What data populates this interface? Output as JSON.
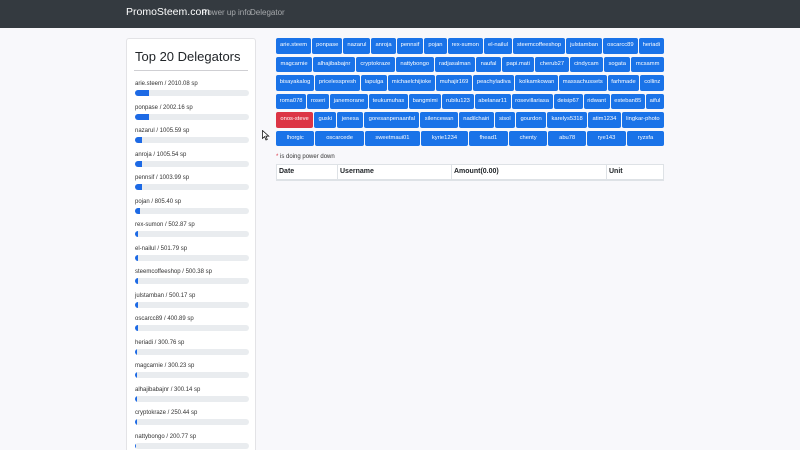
{
  "navbar": {
    "brand": "PromoSteem.com",
    "links": [
      "Power up info",
      "Delegator"
    ]
  },
  "sidebar": {
    "title": "Top 20 Delegators",
    "delegators": [
      {
        "label": "arie.steem / 2010.08 sp",
        "progress": 0.12
      },
      {
        "label": "ponpase / 2002.16 sp",
        "progress": 0.12
      },
      {
        "label": "nazarul / 1005.59 sp",
        "progress": 0.06
      },
      {
        "label": "anroja / 1005.54 sp",
        "progress": 0.06
      },
      {
        "label": "pennsif / 1003.99 sp",
        "progress": 0.06
      },
      {
        "label": "pojan / 805.40 sp",
        "progress": 0.045
      },
      {
        "label": "rex-sumon / 502.87 sp",
        "progress": 0.03
      },
      {
        "label": "el-nailul / 501.79 sp",
        "progress": 0.03
      },
      {
        "label": "steemcoffeeshop / 500.38 sp",
        "progress": 0.03
      },
      {
        "label": "julstamban / 500.17 sp",
        "progress": 0.03
      },
      {
        "label": "oscarcc89 / 400.89 sp",
        "progress": 0.025
      },
      {
        "label": "heriadi / 300.76 sp",
        "progress": 0.02
      },
      {
        "label": "magcarnie / 300.23 sp",
        "progress": 0.02
      },
      {
        "label": "alhajibabajnr / 300.14 sp",
        "progress": 0.02
      },
      {
        "label": "cryptokraze / 250.44 sp",
        "progress": 0.015
      },
      {
        "label": "nattybongo / 200.77 sp",
        "progress": 0.012
      }
    ]
  },
  "user_rows": [
    [
      {
        "name": "arie.steem"
      },
      {
        "name": "ponpase"
      },
      {
        "name": "nazarul"
      },
      {
        "name": "anroja"
      },
      {
        "name": "pennsif"
      },
      {
        "name": "pojan"
      },
      {
        "name": "rex-sumon"
      },
      {
        "name": "el-nailul"
      },
      {
        "name": "steemcoffeeshop"
      },
      {
        "name": "julstamban"
      },
      {
        "name": "oscarcc89"
      },
      {
        "name": "heriadi"
      }
    ],
    [
      {
        "name": "magcarnie"
      },
      {
        "name": "alhajibabajnr"
      },
      {
        "name": "cryptokraze"
      },
      {
        "name": "nattybongo"
      },
      {
        "name": "radjasalman"
      },
      {
        "name": "naufal"
      },
      {
        "name": "papi.mati"
      },
      {
        "name": "cherub27"
      },
      {
        "name": "cindycam"
      },
      {
        "name": "sogata"
      },
      {
        "name": "mcsamm"
      }
    ],
    [
      {
        "name": "bisayakalog"
      },
      {
        "name": "pricelesspresh"
      },
      {
        "name": "lapulga"
      },
      {
        "name": "michaelchijioke"
      },
      {
        "name": "muhajir169"
      },
      {
        "name": "peachyladiva"
      },
      {
        "name": "kolkamkowan"
      },
      {
        "name": "massachussets"
      },
      {
        "name": "farhmade"
      },
      {
        "name": "collinz"
      }
    ],
    [
      {
        "name": "roma078"
      },
      {
        "name": "roseri"
      },
      {
        "name": "janemorane"
      },
      {
        "name": "teukumuhas"
      },
      {
        "name": "bangmimi"
      },
      {
        "name": "rubilu123"
      },
      {
        "name": "abelanar11"
      },
      {
        "name": "rosevillariasa"
      },
      {
        "name": "deisip67"
      },
      {
        "name": "ridwant"
      },
      {
        "name": "esteban85"
      },
      {
        "name": "aiful"
      }
    ],
    [
      {
        "name": "onos-steve",
        "power_down": true
      },
      {
        "name": "guski"
      },
      {
        "name": "jenesa"
      },
      {
        "name": "goresanpenaanfal"
      },
      {
        "name": "silencewan"
      },
      {
        "name": "nadilchairi"
      },
      {
        "name": "sisol"
      },
      {
        "name": "gourdon"
      },
      {
        "name": "karelys5318"
      },
      {
        "name": "atim1234"
      },
      {
        "name": "lingkar-photo"
      }
    ],
    [
      {
        "name": "lhorgic"
      },
      {
        "name": "oscarcede"
      },
      {
        "name": "sweetmaui01"
      },
      {
        "name": "kyrie1234"
      },
      {
        "name": "fhead1"
      },
      {
        "name": "chenty"
      },
      {
        "name": "abu78"
      },
      {
        "name": "rye143"
      },
      {
        "name": "ryzsfa"
      }
    ]
  ],
  "note": {
    "star": "*",
    "text": " is doing power down"
  },
  "table": {
    "headers": [
      "Date",
      "Username",
      "Amount(0.00)",
      "Unit"
    ]
  },
  "colors": {
    "primary": "#1a73e8",
    "danger": "#dc3545",
    "navbar": "#343a40"
  }
}
